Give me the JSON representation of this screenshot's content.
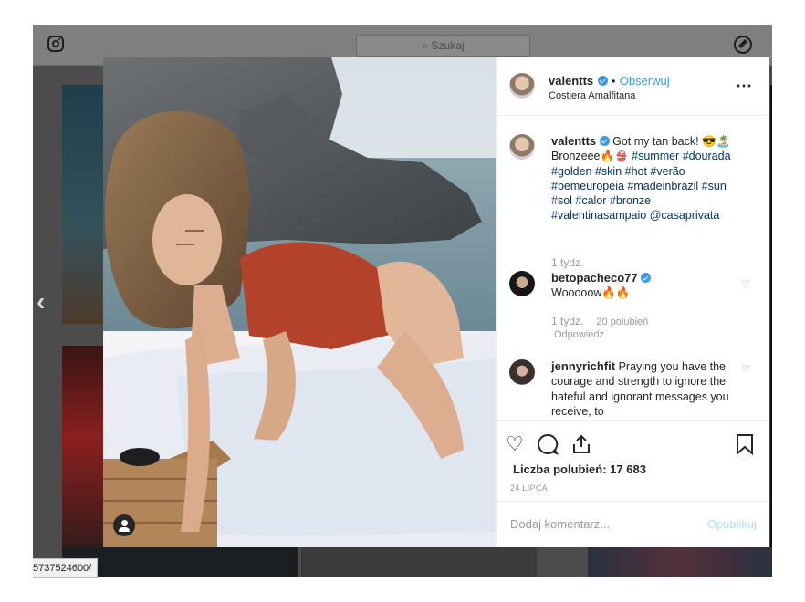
{
  "topbar": {
    "search_placeholder": "Szukaj"
  },
  "status_url": "5737524600/",
  "post": {
    "username": "valentts",
    "follow_label": "Obserwuj",
    "separator": "•",
    "location": "Costiera Amalfitana",
    "more": "•••",
    "caption": {
      "username": "valentts",
      "text": "Got my tan back! 😎🏝️ Bronzeee🔥👙",
      "hashtags": "#summer #dourada #golden #skin #hot #verão #bemeuropeia #madeinbrazil #sun #sol #calor #bronze #valentinasampaio @casaprivata",
      "time": "1 tydz."
    },
    "comments": [
      {
        "username": "betopacheco77",
        "text": "Wooooow🔥🔥",
        "time": "1 tydz.",
        "likes": "20 polubień",
        "reply": "Odpowiedz"
      },
      {
        "username": "jennyrichfit",
        "text": "Praying you have the courage and strength to ignore the hateful and ignorant messages you receive, to"
      }
    ],
    "likes_label": "Liczba polubień: 17 683",
    "date": "24 LIPCA",
    "comment_placeholder": "Dodaj komentarz...",
    "publish_label": "Opublikuj"
  },
  "colors": {
    "accent": "#3897f0",
    "hashtag": "#003569"
  }
}
